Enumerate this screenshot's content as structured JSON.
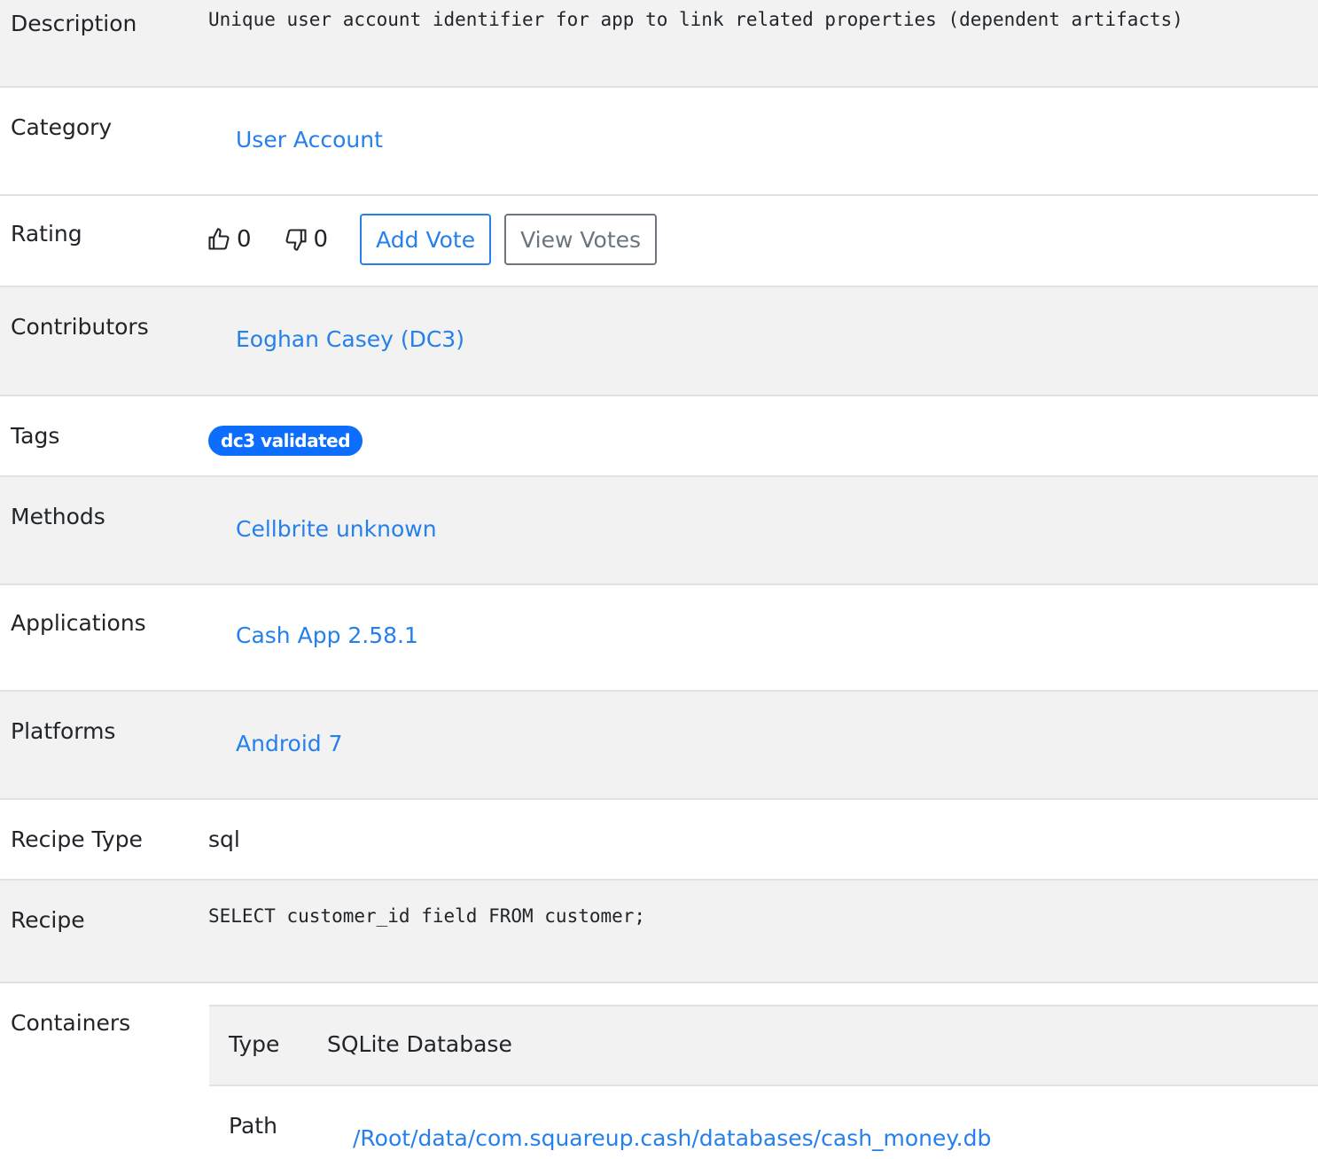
{
  "rows": {
    "description": {
      "label": "Description",
      "value": "Unique user account identifier for app to link related properties (dependent artifacts)"
    },
    "category": {
      "label": "Category",
      "value": "User Account"
    },
    "rating": {
      "label": "Rating",
      "up_count": "0",
      "down_count": "0",
      "add_vote_label": "Add Vote",
      "view_votes_label": "View Votes"
    },
    "contributors": {
      "label": "Contributors",
      "value": "Eoghan Casey (DC3)"
    },
    "tags": {
      "label": "Tags",
      "badge": "dc3 validated"
    },
    "methods": {
      "label": "Methods",
      "value": "Cellbrite unknown"
    },
    "applications": {
      "label": "Applications",
      "value": "Cash App 2.58.1"
    },
    "platforms": {
      "label": "Platforms",
      "value": "Android 7"
    },
    "recipe_type": {
      "label": "Recipe Type",
      "value": "sql"
    },
    "recipe": {
      "label": "Recipe",
      "value": "SELECT customer_id field FROM customer;"
    },
    "containers": {
      "label": "Containers",
      "type_label": "Type",
      "type_value": "SQLite Database",
      "path_label": "Path",
      "path_value": "/Root/data/com.squareup.cash/databases/cash_money.db"
    }
  },
  "colors": {
    "link": "#2680eb",
    "badge": "#0d6efd",
    "row_shade": "#f2f2f2",
    "border": "#dee2e6"
  },
  "icons": [
    "thumbs-up-icon",
    "thumbs-down-icon"
  ]
}
